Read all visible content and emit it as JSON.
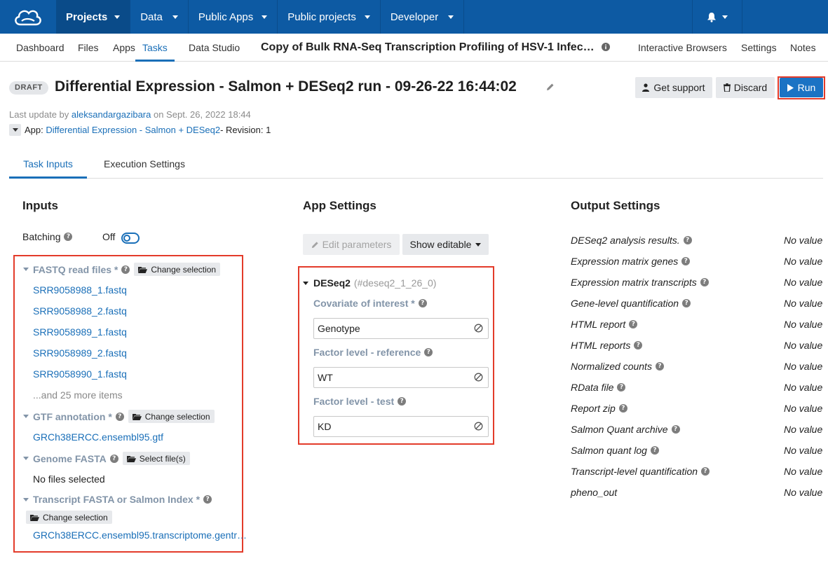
{
  "topnav": {
    "items": [
      {
        "label": "Projects",
        "active": true
      },
      {
        "label": "Data"
      },
      {
        "label": "Public Apps"
      },
      {
        "label": "Public projects"
      },
      {
        "label": "Developer"
      }
    ]
  },
  "subnav": {
    "left_items": [
      "Dashboard",
      "Files",
      "Apps",
      "Tasks",
      "Data Studio"
    ],
    "active": "Tasks",
    "project_title": "Copy of Bulk RNA-Seq Transcription Profiling of HSV-1 Infec…",
    "right_items": [
      "Interactive Browsers",
      "Settings",
      "Notes"
    ]
  },
  "header": {
    "badge": "DRAFT",
    "title": "Differential Expression - Salmon + DESeq2 run - 09-26-22 16:44:02",
    "get_support": "Get support",
    "discard": "Discard",
    "run": "Run"
  },
  "meta": {
    "prefix": "Last update by ",
    "user": "aleksandargazibara",
    "suffix": " on Sept. 26, 2022 18:44",
    "app_prefix": "App: ",
    "app_name": "Differential Expression - Salmon + DESeq2",
    "revision": " - Revision: 1"
  },
  "tabs": [
    "Task Inputs",
    "Execution Settings"
  ],
  "inputs": {
    "title": "Inputs",
    "batching_label": "Batching",
    "batching_value": "Off",
    "fastq_label": "FASTQ read files *",
    "change_selection": "Change selection",
    "fastq_files": [
      "SRR9058988_1.fastq",
      "SRR9058988_2.fastq",
      "SRR9058989_1.fastq",
      "SRR9058989_2.fastq",
      "SRR9058990_1.fastq"
    ],
    "more_items": "...and 25 more items",
    "gtf_label": "GTF annotation *",
    "gtf_file": "GRCh38ERCC.ensembl95.gtf",
    "genome_label": "Genome FASTA",
    "select_files": "Select file(s)",
    "no_files": "No files selected",
    "transcript_label": "Transcript FASTA or Salmon Index *",
    "transcript_file": "GRCh38ERCC.ensembl95.transcriptome.gentr…"
  },
  "app_settings": {
    "title": "App Settings",
    "edit_parameters": "Edit parameters",
    "show_editable": "Show editable",
    "node_name": "DESeq2",
    "node_id": "(#deseq2_1_26_0)",
    "params": [
      {
        "label": "Covariate of interest *",
        "value": "Genotype"
      },
      {
        "label": "Factor level - reference",
        "value": "WT"
      },
      {
        "label": "Factor level - test",
        "value": "KD"
      }
    ]
  },
  "output_settings": {
    "title": "Output Settings",
    "no_value": "No value",
    "outputs": [
      {
        "label": "DESeq2 analysis results.",
        "help": true
      },
      {
        "label": "Expression matrix genes",
        "help": true
      },
      {
        "label": "Expression matrix transcripts",
        "help": true
      },
      {
        "label": "Gene-level quantification",
        "help": true
      },
      {
        "label": "HTML report",
        "help": true
      },
      {
        "label": "HTML reports",
        "help": true
      },
      {
        "label": "Normalized counts",
        "help": true
      },
      {
        "label": "RData file",
        "help": true
      },
      {
        "label": "Report zip",
        "help": true
      },
      {
        "label": "Salmon Quant archive",
        "help": true
      },
      {
        "label": "Salmon quant log",
        "help": true
      },
      {
        "label": "Transcript-level quantification",
        "help": true
      },
      {
        "label": "pheno_out",
        "help": false
      }
    ]
  },
  "colors": {
    "nav_bg": "#0d5aa3",
    "accent": "#1a6fb8",
    "highlight_box": "#e33b2a"
  }
}
